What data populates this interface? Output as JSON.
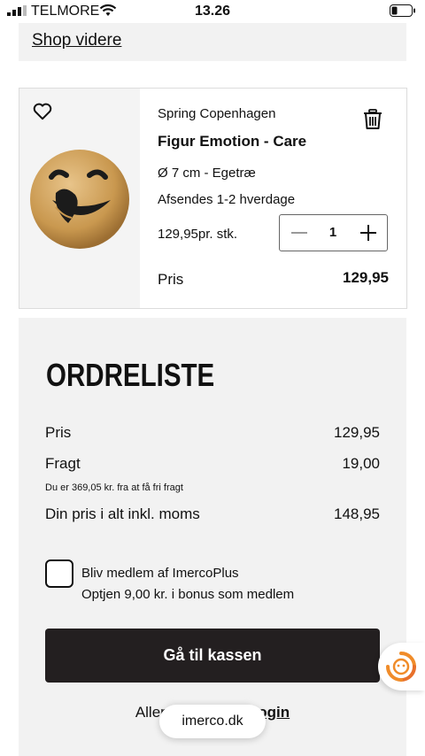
{
  "status_bar": {
    "carrier": "TELMORE",
    "time": "13.26"
  },
  "shop_link": "Shop videre",
  "product": {
    "brand": "Spring Copenhagen",
    "title": "Figur Emotion - Care",
    "variant": "Ø 7 cm - Egetræ",
    "shipping": "Afsendes 1-2 hverdage",
    "unit_price": "129,95pr. stk.",
    "quantity": "1",
    "price_label": "Pris",
    "price_value": "129,95"
  },
  "order": {
    "title": "ORDRELISTE",
    "rows": [
      {
        "label": "Pris",
        "value": "129,95"
      },
      {
        "label": "Fragt",
        "value": "19,00"
      },
      {
        "label": "Din pris i alt inkl. moms",
        "value": "148,95"
      }
    ],
    "free_shipping_note": "Du er 369,05 kr. fra at få fri fragt",
    "membership_label": "Bliv medlem af ImercoPlus",
    "membership_bonus": "Optjen 9,00 kr. i bonus som medlem",
    "checkout_label": "Gå til kassen",
    "login_prefix": "Allere",
    "login_link": "ogin"
  },
  "browser": {
    "domain": "imerco.dk"
  },
  "colors": {
    "checkout_bg": "#231f20",
    "panel_bg": "#f2f2f2",
    "chat_orange": "#f08c2a"
  }
}
